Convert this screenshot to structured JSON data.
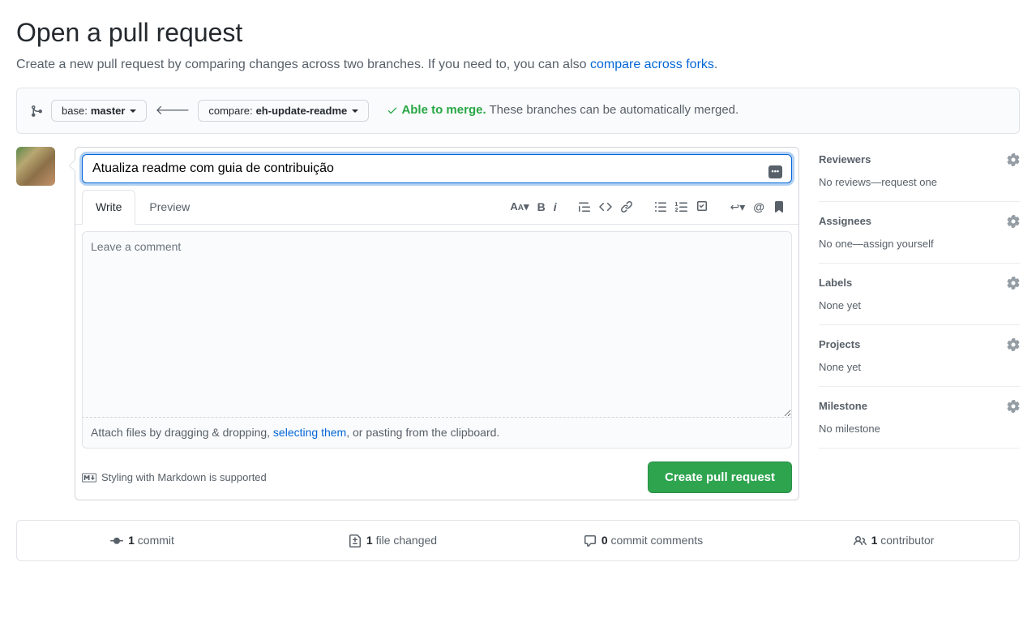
{
  "page": {
    "title": "Open a pull request",
    "subtitle_prefix": "Create a new pull request by comparing changes across two branches. If you need to, you can also ",
    "subtitle_link": "compare across forks",
    "subtitle_suffix": "."
  },
  "compare": {
    "base_prefix": "base: ",
    "base_branch": "master",
    "compare_prefix": "compare: ",
    "compare_branch": "eh-update-readme",
    "merge_status_ok": "Able to merge.",
    "merge_status_desc": " These branches can be automatically merged."
  },
  "editor": {
    "title_value": "Atualiza readme com guia de contribuição",
    "title_badge": "•••",
    "tabs": {
      "write": "Write",
      "preview": "Preview"
    },
    "body_placeholder": "Leave a comment",
    "attach_prefix": "Attach files by dragging & dropping, ",
    "attach_link": "selecting them",
    "attach_suffix": ", or pasting from the clipboard.",
    "markdown_hint": "Styling with Markdown is supported",
    "create_button": "Create pull request"
  },
  "sidebar": {
    "reviewers": {
      "title": "Reviewers",
      "body": "No reviews—request one"
    },
    "assignees": {
      "title": "Assignees",
      "body_prefix": "No one—",
      "body_link": "assign yourself"
    },
    "labels": {
      "title": "Labels",
      "body": "None yet"
    },
    "projects": {
      "title": "Projects",
      "body": "None yet"
    },
    "milestone": {
      "title": "Milestone",
      "body": "No milestone"
    }
  },
  "stats": {
    "commits_count": "1",
    "commits_label": " commit",
    "files_count": "1",
    "files_label": " file changed",
    "comments_count": "0",
    "comments_label": " commit comments",
    "contributors_count": "1",
    "contributors_label": " contributor"
  }
}
